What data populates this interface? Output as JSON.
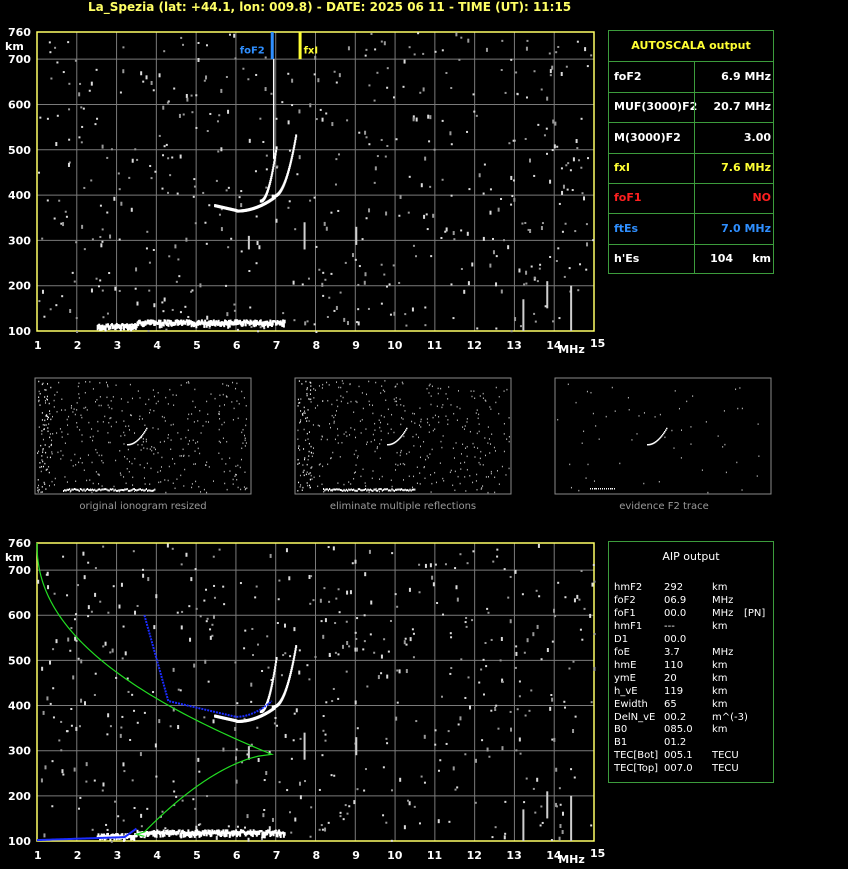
{
  "header": {
    "title": "La_Spezia (lat: +44.1, lon: 009.8) - DATE: 2025 06 11 - TIME (UT): 11:15"
  },
  "ionogram_top": {
    "y_unit": "km",
    "x_unit": "MHz",
    "y_ticks": [
      "760",
      "700",
      "600",
      "500",
      "400",
      "300",
      "200",
      "100"
    ],
    "x_ticks": [
      "1",
      "2",
      "3",
      "4",
      "5",
      "6",
      "7",
      "8",
      "9",
      "10",
      "11",
      "12",
      "13",
      "14",
      "15"
    ],
    "markers": [
      {
        "label": "foF2",
        "freq_mhz": 6.9,
        "color": "#2f8fff"
      },
      {
        "label": "fxI",
        "freq_mhz": 7.6,
        "color": "#ffff33"
      }
    ]
  },
  "autoscala": {
    "title": "AUTOSCALA output",
    "rows": [
      {
        "key": "foF2",
        "value": "6.9 MHz",
        "key_color": "#ffffff",
        "value_color": "#ffffff"
      },
      {
        "key": "MUF(3000)F2",
        "value": "20.7 MHz",
        "key_color": "#ffffff",
        "value_color": "#ffffff"
      },
      {
        "key": "M(3000)F2",
        "value": "3.00",
        "key_color": "#ffffff",
        "value_color": "#ffffff"
      },
      {
        "key": "fxI",
        "value": "7.6 MHz",
        "key_color": "#ffff33",
        "value_color": "#ffff33"
      },
      {
        "key": "foF1",
        "value": "NO",
        "key_color": "#ff2020",
        "value_color": "#ff2020"
      },
      {
        "key": "ftEs",
        "value": "7.0 MHz",
        "key_color": "#2f8fff",
        "value_color": "#2f8fff"
      },
      {
        "key": "h'Es",
        "value": "104     km",
        "key_color": "#ffffff",
        "value_color": "#ffffff"
      }
    ]
  },
  "thumbnails": [
    {
      "caption": "original ionogram resized"
    },
    {
      "caption": "eliminate multiple reflections"
    },
    {
      "caption": "evidence F2 trace"
    }
  ],
  "ionogram_bottom": {
    "y_unit": "km",
    "x_unit": "MHz",
    "y_ticks": [
      "760",
      "700",
      "600",
      "500",
      "400",
      "300",
      "200",
      "100"
    ],
    "x_ticks": [
      "1",
      "2",
      "3",
      "4",
      "5",
      "6",
      "7",
      "8",
      "9",
      "10",
      "11",
      "12",
      "13",
      "14",
      "15"
    ]
  },
  "aip": {
    "title": "AIP output",
    "rows": [
      {
        "k": "hmF2",
        "v": "292",
        "u": "km",
        "x": ""
      },
      {
        "k": "foF2",
        "v": "06.9",
        "u": "MHz",
        "x": ""
      },
      {
        "k": "foF1",
        "v": "00.0",
        "u": "MHz",
        "x": "[PN]"
      },
      {
        "k": "hmF1",
        "v": "---",
        "u": "km",
        "x": ""
      },
      {
        "k": "D1",
        "v": "00.0",
        "u": "",
        "x": ""
      },
      {
        "k": "foE",
        "v": "3.7",
        "u": "MHz",
        "x": ""
      },
      {
        "k": "hmE",
        "v": "110",
        "u": "km",
        "x": ""
      },
      {
        "k": "ymE",
        "v": "20",
        "u": "km",
        "x": ""
      },
      {
        "k": "h_vE",
        "v": "119",
        "u": "km",
        "x": ""
      },
      {
        "k": "Ewidth",
        "v": "65",
        "u": "km",
        "x": ""
      },
      {
        "k": "DelN_vE",
        "v": "00.2",
        "u": "m^(-3)",
        "x": ""
      },
      {
        "k": "B0",
        "v": "085.0",
        "u": "km",
        "x": ""
      },
      {
        "k": "B1",
        "v": "01.2",
        "u": "",
        "x": ""
      },
      {
        "k": "TEC[Bot]",
        "v": "005.1",
        "u": "TECU",
        "x": ""
      },
      {
        "k": "TEC[Top]",
        "v": "007.0",
        "u": "TECU",
        "x": ""
      }
    ]
  },
  "colors": {
    "axis": "#ffff66",
    "grid": "#7a7a7a",
    "border_green": "#3c9c3c",
    "profile": "#22dd22",
    "trace_fit": "#1a2cff"
  }
}
